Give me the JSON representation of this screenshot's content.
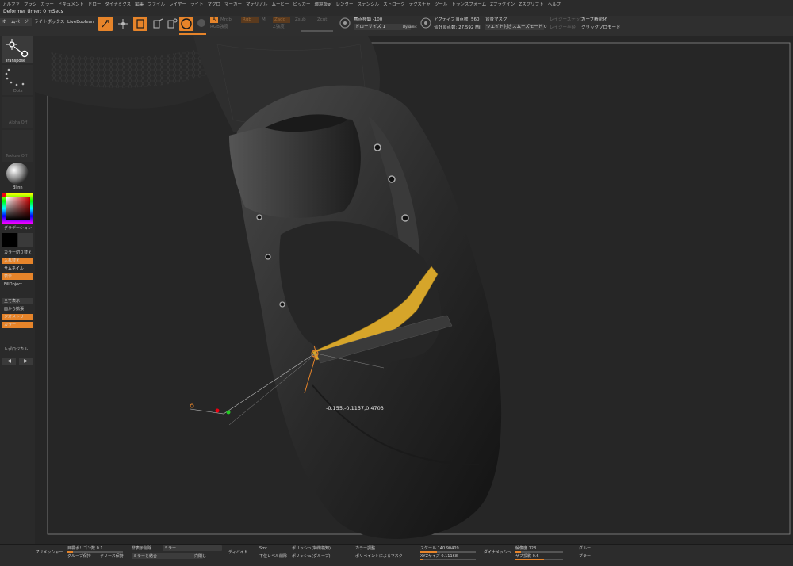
{
  "menubar": [
    "アルファ",
    "ブラシ",
    "カラー",
    "ドキュメント",
    "ドロー",
    "ダイナミクス",
    "編集",
    "ファイル",
    "レイヤー",
    "ライト",
    "マクロ",
    "マーカー",
    "マテリアル",
    "ムービー",
    "ピッカー",
    "環境設定",
    "レンダー",
    "ステンシル",
    "ストローク",
    "テクスチャ",
    "ツール",
    "トランスフォーム",
    "Zプラグイン",
    "Zスクリプト",
    "ヘルプ"
  ],
  "title": "Deformer timer: 0 mSecs",
  "shelf": {
    "home": "ホームページ",
    "lightbox": "ライトボックス",
    "liveboolean": "LiveBoolean",
    "a_label": "A",
    "mrgb": "Mrgb",
    "rgb": "Rgb",
    "m": "M",
    "zadd": "Zadd",
    "zsub": "Zsub",
    "zcut": "Zcut",
    "rgb_intensity": "RGB強度",
    "z_intensity": "Z強度",
    "focal_shift": "焦点移動 -100",
    "draw_size": "ドローサイズ 1",
    "dynamic": "Dynamic",
    "active_points": "アクティブ頂点数: 560",
    "total_points": "合計頂点数: 27.592 Mil",
    "bg_mask": "背景マスク",
    "weighted_smooth": "ウエイト付きスムーズモード 0",
    "lazystep": "レイジーステップ",
    "lazyradius": "レイジー半径",
    "curve_precise": "カーブ精密化",
    "click_solo": "クリックソロモード"
  },
  "tray": {
    "transpose": "Transpose",
    "dots": "Dots",
    "alpha_off": "Alpha Off",
    "texture_off": "Texture Off",
    "material": "Blinn",
    "gradient": "グラデーション",
    "color_switch": "カラー切り替え",
    "swap": "入れ替え",
    "thumbnail": "サムネイル",
    "display": "表示",
    "fillobject": "FillObject",
    "all_display": "全て表示",
    "from_mesh": "面から拡張",
    "geometry": "ジオメトリ",
    "color": "カラー",
    "topological": "トポロジカル"
  },
  "canvas": {
    "coordinates": "-0.155,-0.1157,0.4703"
  },
  "bottom": {
    "zremesher": "Zリメッシャー",
    "target_poly": "目標ポリゴン数 0.1",
    "half": "半分",
    "remove_hidden": "非表示削除",
    "mirror": "ミラー",
    "keep_groups": "グループ保持",
    "keep_creases": "クリース保持",
    "mirror_weld": "ミラーと結合",
    "close_holes": "穴閉じ",
    "divide": "ディバイド",
    "smt": "Smt",
    "polish_feature": "ポリッシュ(特徴検知)",
    "lower_subdiv": "下位レベル削除",
    "polish_groups": "ポリッシュ(グループ)",
    "color_adjust": "カラー調整",
    "polish_mask": "ポリペイントによるマスク",
    "scale": "スケール 140.90409",
    "xyz_size": "XYZサイズ 0.11168",
    "dynamesh": "ダイナメッシュ",
    "resolution": "解像度 128",
    "sub_proj": "サブ投影 0.6",
    "group": "グルー",
    "blur": "ブラー"
  },
  "colors": {
    "accent": "#e6842a",
    "shoe": "#2b2b2b",
    "strap": "#d6a52a"
  }
}
